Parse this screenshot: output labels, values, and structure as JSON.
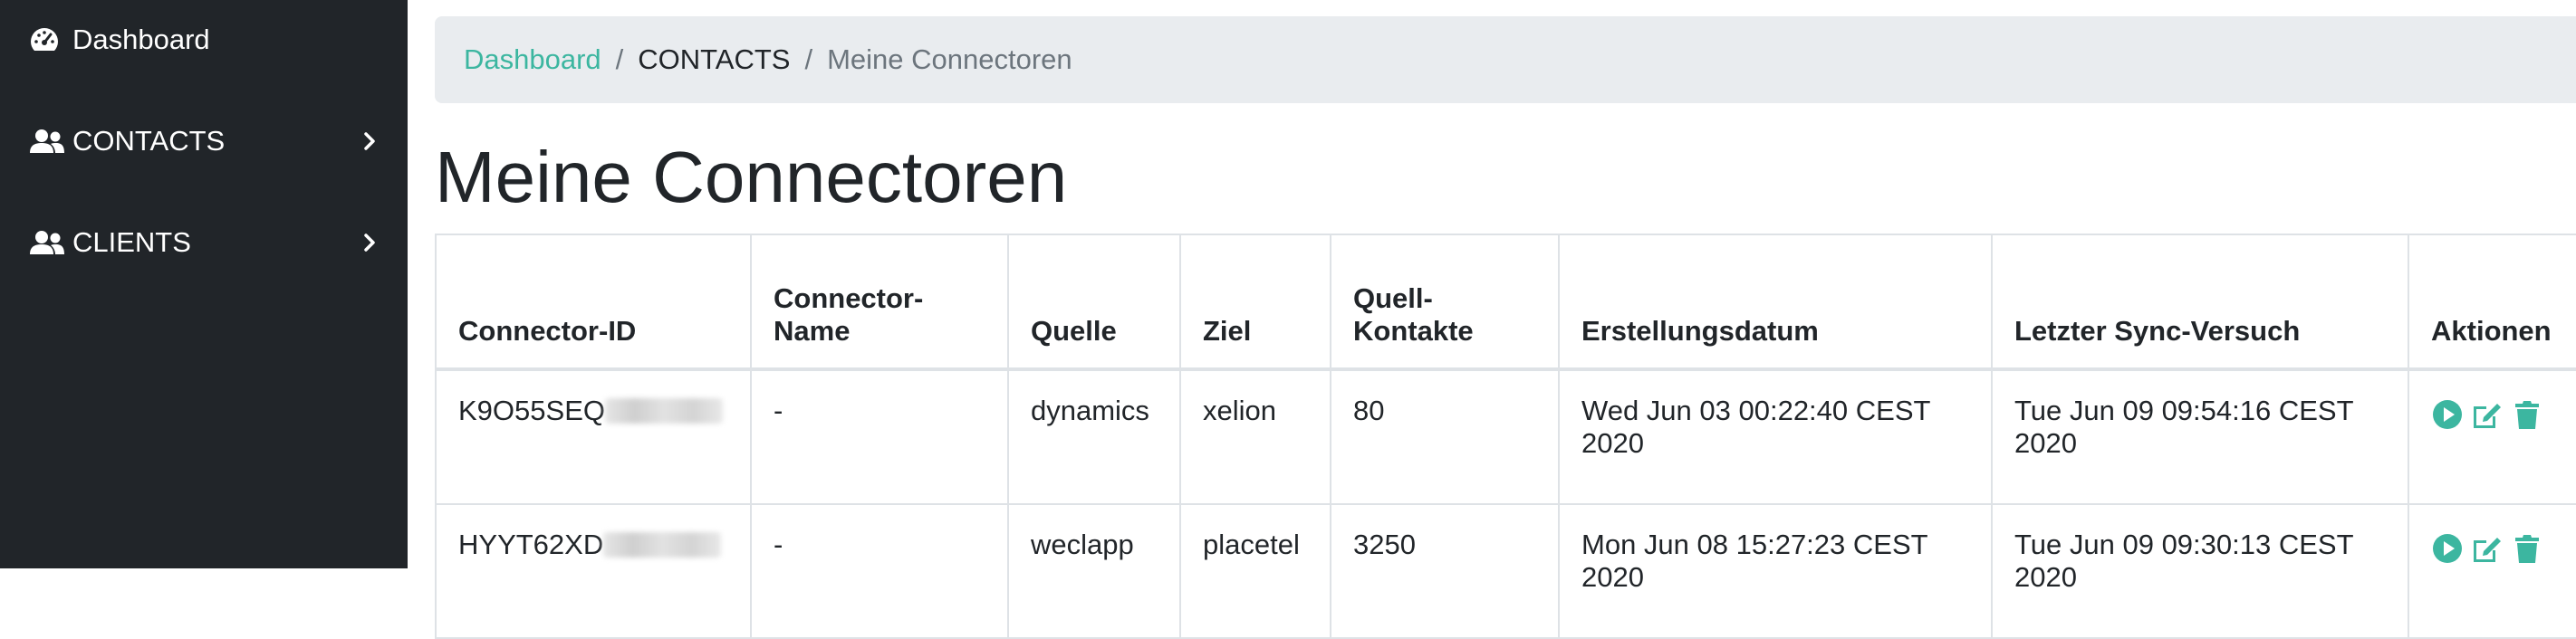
{
  "colors": {
    "sidebar_bg": "#212529",
    "accent": "#3cb6a0",
    "breadcrumb_bg": "#e9ecef"
  },
  "sidebar": {
    "items": [
      {
        "label": "Dashboard",
        "icon": "gauge-icon"
      },
      {
        "label": "CONTACTS",
        "icon": "users-icon",
        "chevron": "chevron-right-icon"
      },
      {
        "label": "CLIENTS",
        "icon": "users-icon",
        "chevron": "chevron-right-icon"
      }
    ]
  },
  "breadcrumb": {
    "items": [
      "Dashboard",
      "CONTACTS",
      "Meine Connectoren"
    ],
    "separator": "/"
  },
  "page": {
    "title": "Meine Connectoren"
  },
  "table": {
    "headers": [
      "Connector-ID",
      "Connector-Name",
      "Quelle",
      "Ziel",
      "Quell-Kontakte",
      "Erstellungsdatum",
      "Letzter Sync-Versuch",
      "Aktionen"
    ],
    "headers_display": [
      "Connector-ID",
      "Connector-\nName",
      "Quelle",
      "Ziel",
      "Quell-\nKontakte",
      "Erstellungsdatum",
      "Letzter Sync-Versuch",
      "Aktionen"
    ],
    "rows": [
      {
        "id": "K9O55SEQ",
        "name": "-",
        "quelle": "dynamics",
        "ziel": "xelion",
        "kontakte": "80",
        "erstellt": "Wed Jun 03 00:22:40 CEST 2020",
        "sync": "Tue Jun 09 09:54:16 CEST 2020"
      },
      {
        "id": "HYYT62XD",
        "name": "-",
        "quelle": "weclapp",
        "ziel": "placetel",
        "kontakte": "3250",
        "erstellt": "Mon Jun 08 15:27:23 CEST 2020",
        "sync": "Tue Jun 09 09:30:13 CEST 2020"
      }
    ],
    "action_icons": [
      "play-icon",
      "edit-icon",
      "trash-icon"
    ]
  }
}
